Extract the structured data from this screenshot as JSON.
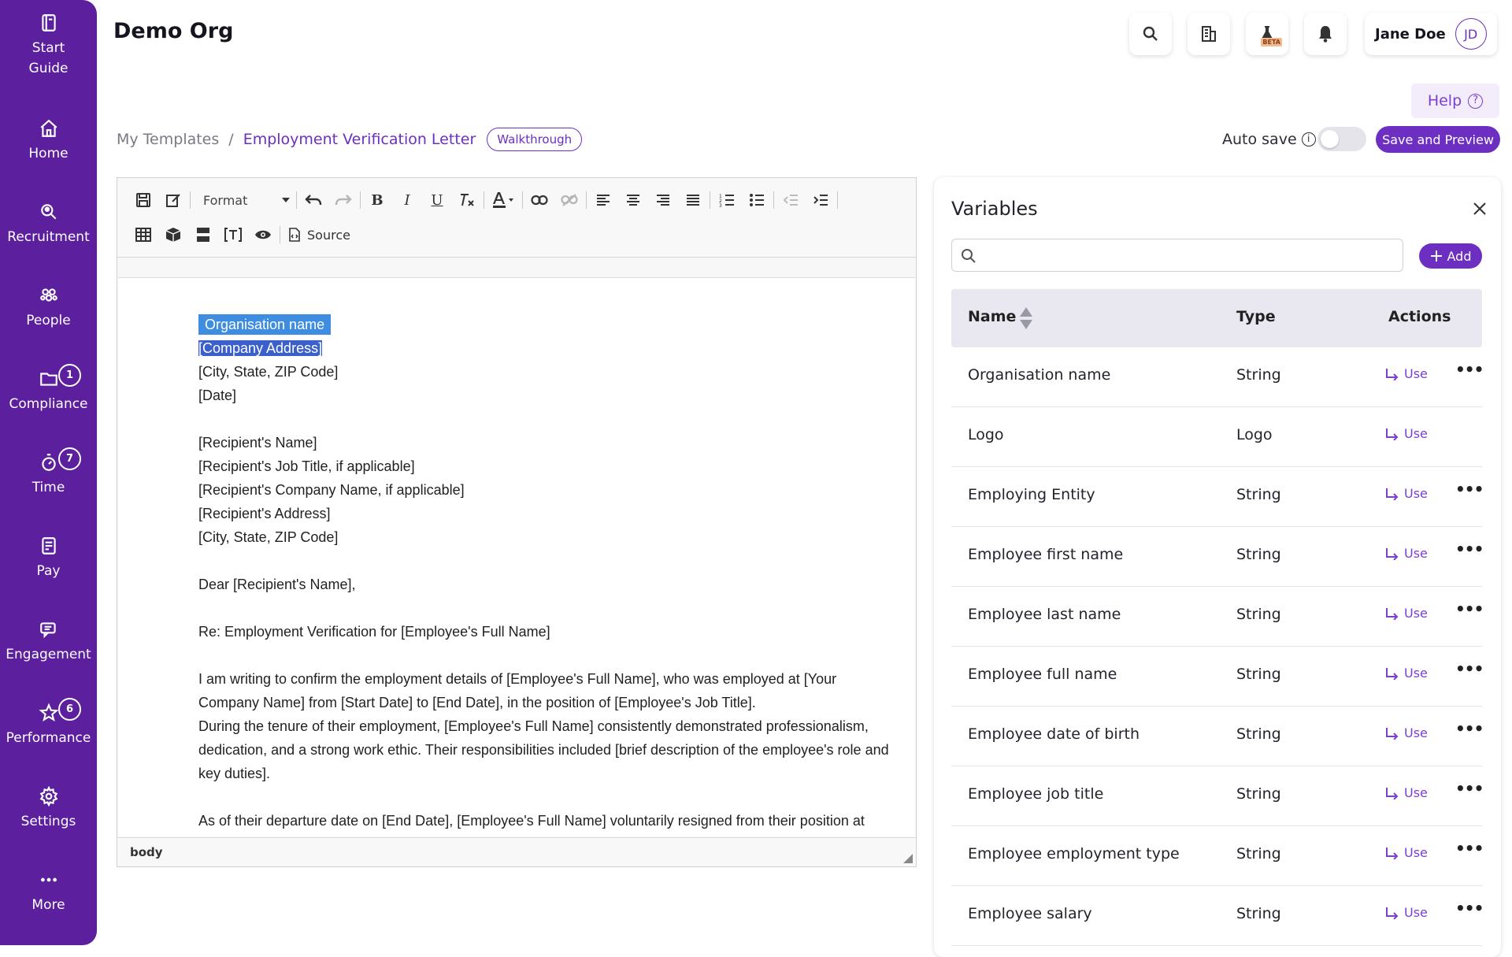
{
  "sidebar": {
    "items": [
      {
        "label_lines": [
          "Start",
          "Guide"
        ],
        "icon": "book-icon"
      },
      {
        "label": "Home",
        "icon": "home-icon"
      },
      {
        "label": "Recruitment",
        "icon": "search-person-icon"
      },
      {
        "label": "People",
        "icon": "people-icon"
      },
      {
        "label": "Compliance",
        "icon": "folder-icon",
        "badge": "1"
      },
      {
        "label": "Time",
        "icon": "timer-icon",
        "badge": "7"
      },
      {
        "label": "Pay",
        "icon": "payslip-icon"
      },
      {
        "label": "Engagement",
        "icon": "chat-icon"
      },
      {
        "label": "Performance",
        "icon": "star-icon",
        "badge": "6"
      },
      {
        "label": "Settings",
        "icon": "gear-icon"
      },
      {
        "label": "More",
        "icon": "dots-icon"
      }
    ]
  },
  "header": {
    "org_name": "Demo Org",
    "beta_label": "BETA",
    "user_name": "Jane Doe",
    "user_initials": "JD"
  },
  "help": {
    "label": "Help",
    "icon": "?"
  },
  "breadcrumb": {
    "root": "My Templates",
    "separator": "/",
    "current": "Employment Verification Letter",
    "walkthrough": "Walkthrough"
  },
  "autosave": {
    "label": "Auto save",
    "info": "i",
    "enabled": false
  },
  "save_preview": "Save and Preview",
  "editor": {
    "format_label": "Format",
    "source_label": "Source",
    "status_path": "body",
    "doc": {
      "var_tag": "Organisation name",
      "selected_line": "[Company Address]",
      "sender_lines": [
        "[City, State, ZIP Code]",
        "[Date]"
      ],
      "recipient_lines": [
        "[Recipient's Name]",
        "[Recipient's Job Title, if applicable]",
        "[Recipient's Company Name, if applicable]",
        "[Recipient's Address]",
        "[City, State, ZIP Code]"
      ],
      "salutation": "Dear [Recipient's Name],",
      "subject": "Re: Employment Verification for [Employee's Full Name]",
      "para1": "I am writing to confirm the employment details of [Employee's Full Name], who was employed at [Your Company Name] from [Start Date] to [End Date], in the position of [Employee's Job Title].",
      "para2": "During the tenure of their employment, [Employee's Full Name] consistently demonstrated professionalism, dedication, and a strong work ethic. Their responsibilities included [brief description of the employee's role and key duties].",
      "para3": "As of their departure date on [End Date], [Employee's Full Name] voluntarily resigned from their position at"
    }
  },
  "variables": {
    "title": "Variables",
    "search_placeholder": "",
    "add_label": "Add",
    "columns": {
      "name": "Name",
      "type": "Type",
      "actions": "Actions"
    },
    "use_label": "Use",
    "more_label": "•••",
    "rows": [
      {
        "name": "Organisation name",
        "type": "String",
        "more": true
      },
      {
        "name": "Logo",
        "type": "Logo",
        "more": false
      },
      {
        "name": "Employing Entity",
        "type": "String",
        "more": true
      },
      {
        "name": "Employee first name",
        "type": "String",
        "more": true
      },
      {
        "name": "Employee last name",
        "type": "String",
        "more": true
      },
      {
        "name": "Employee full name",
        "type": "String",
        "more": true
      },
      {
        "name": "Employee date of birth",
        "type": "String",
        "more": true
      },
      {
        "name": "Employee job title",
        "type": "String",
        "more": true
      },
      {
        "name": "Employee employment type",
        "type": "String",
        "more": true
      },
      {
        "name": "Employee salary",
        "type": "String",
        "more": true
      }
    ]
  }
}
